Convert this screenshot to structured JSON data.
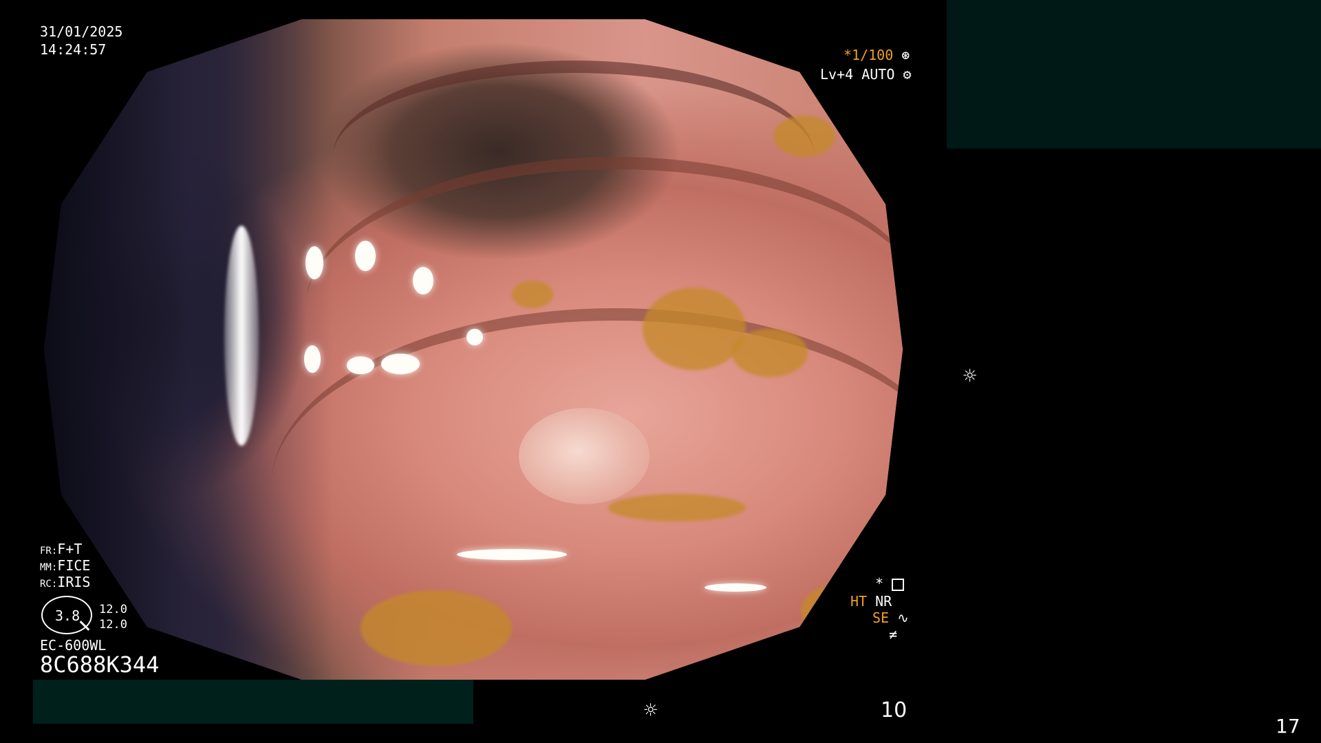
{
  "info_top_left": {
    "date": "31/01/2025",
    "time": "14:24:57"
  },
  "info_top_right": {
    "shutter": "*1/100",
    "level": "Lv+4",
    "auto": "AUTO"
  },
  "info_left_settings": {
    "fr_label": "FR:",
    "fr_value": "F+T",
    "mm_label": "MM:",
    "mm_value": "FICE",
    "rc_label": "RC:",
    "rc_value": "IRIS",
    "zoom_value": "3.8",
    "side_value_1": "12.0",
    "side_value_2": "12.0"
  },
  "scope_info": {
    "model": "EC-600WL",
    "serial": "8C688K344"
  },
  "info_bottom_right_icons": {
    "star": "*",
    "ht": "HT",
    "nr": "NR",
    "se": "SE"
  },
  "bottom_bar": {
    "frame_number": "10",
    "page_number": "17"
  },
  "colors": {
    "osd_text": "#ffffff",
    "highlight": "#f0a020",
    "overlay_panel": "#001816"
  },
  "icons": [
    "brightness-icon",
    "aperture-icon",
    "gear-icon",
    "mode-icon",
    "wave-icon",
    "slash-icon"
  ]
}
